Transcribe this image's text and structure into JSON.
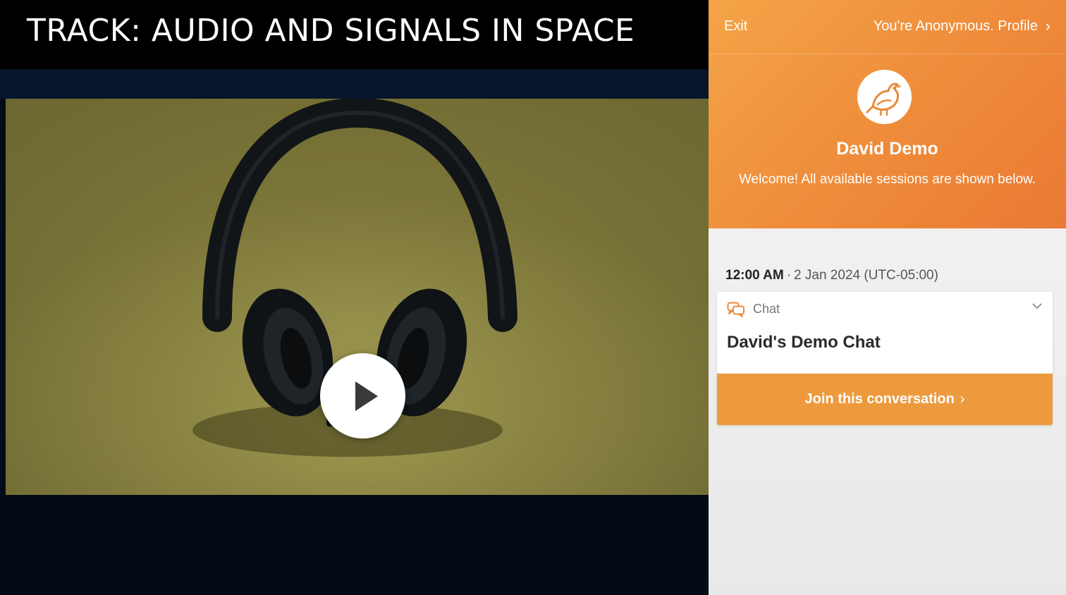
{
  "video": {
    "track_title": "TRACK: AUDIO AND SIGNALS IN SPACE",
    "play_icon": "play-icon"
  },
  "panel": {
    "exit_label": "Exit",
    "profile_label": "You're Anonymous. Profile",
    "profile_chevron": "›",
    "avatar_icon": "bird-icon",
    "user_name": "David Demo",
    "welcome_message": "Welcome! All available sessions are shown below.",
    "session": {
      "time": "12:00 AM",
      "separator": "·",
      "date": "2 Jan 2024 (UTC-05:00)"
    },
    "chat_card": {
      "type_label": "Chat",
      "name": "David's Demo Chat"
    },
    "join_label": "Join this conversation",
    "join_chevron": "›"
  },
  "colors": {
    "accent_orange": "#ed9a3e",
    "header_orange": "#ee8b3a",
    "video_bg": "#050c18"
  }
}
